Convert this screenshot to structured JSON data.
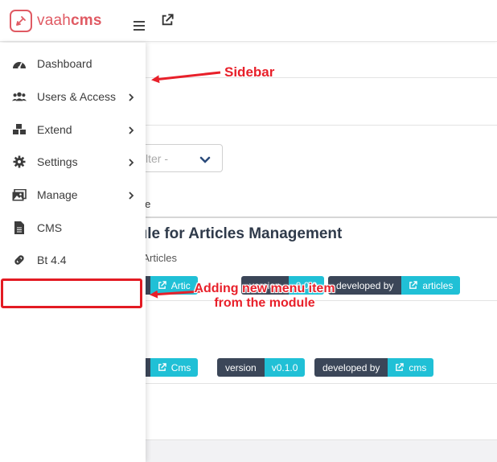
{
  "app": {
    "logo_text_prefix": "vaah",
    "logo_text_bold": "cms",
    "brand_color": "#e05a63"
  },
  "topbar": {
    "menu_icon": "hamburger-icon",
    "external_icon": "external-link-icon"
  },
  "sidebar": {
    "items": [
      {
        "label": "Dashboard",
        "icon": "dashboard-gauge-icon",
        "has_submenu": false
      },
      {
        "label": "Users & Access",
        "icon": "users-icon",
        "has_submenu": true
      },
      {
        "label": "Extend",
        "icon": "cubes-icon",
        "has_submenu": true
      },
      {
        "label": "Settings",
        "icon": "gear-icon",
        "has_submenu": true
      },
      {
        "label": "Manage",
        "icon": "images-icon",
        "has_submenu": true
      },
      {
        "label": "CMS",
        "icon": "file-icon",
        "has_submenu": false
      },
      {
        "label": "Bt 4.4",
        "icon": "link-icon",
        "has_submenu": false
      }
    ],
    "new_item_highlight": ""
  },
  "main": {
    "filter_placeholder": "- Filter -",
    "filter_placeholder_visible": "lter -",
    "column_header_visible": "ule",
    "module1": {
      "title_visible": "dule for Articles Management",
      "description_visible": "ge Articles",
      "tags": [
        {
          "key_visible": "e",
          "value_visible": "Artic"
        },
        {
          "key_visible": "version",
          "value_visible": "0.0.0"
        },
        {
          "key": "developed by",
          "value": "articles"
        }
      ]
    },
    "module2": {
      "name_visible": "s",
      "tags": [
        {
          "key_visible": "e",
          "value": "Cms"
        },
        {
          "key": "version",
          "value": "v0.1.0"
        },
        {
          "key": "developed by",
          "value": "cms"
        }
      ]
    }
  },
  "annotations": {
    "sidebar_label": "Sidebar",
    "new_item_label": "Adding new menu item from the module",
    "color": "#e8202a"
  }
}
